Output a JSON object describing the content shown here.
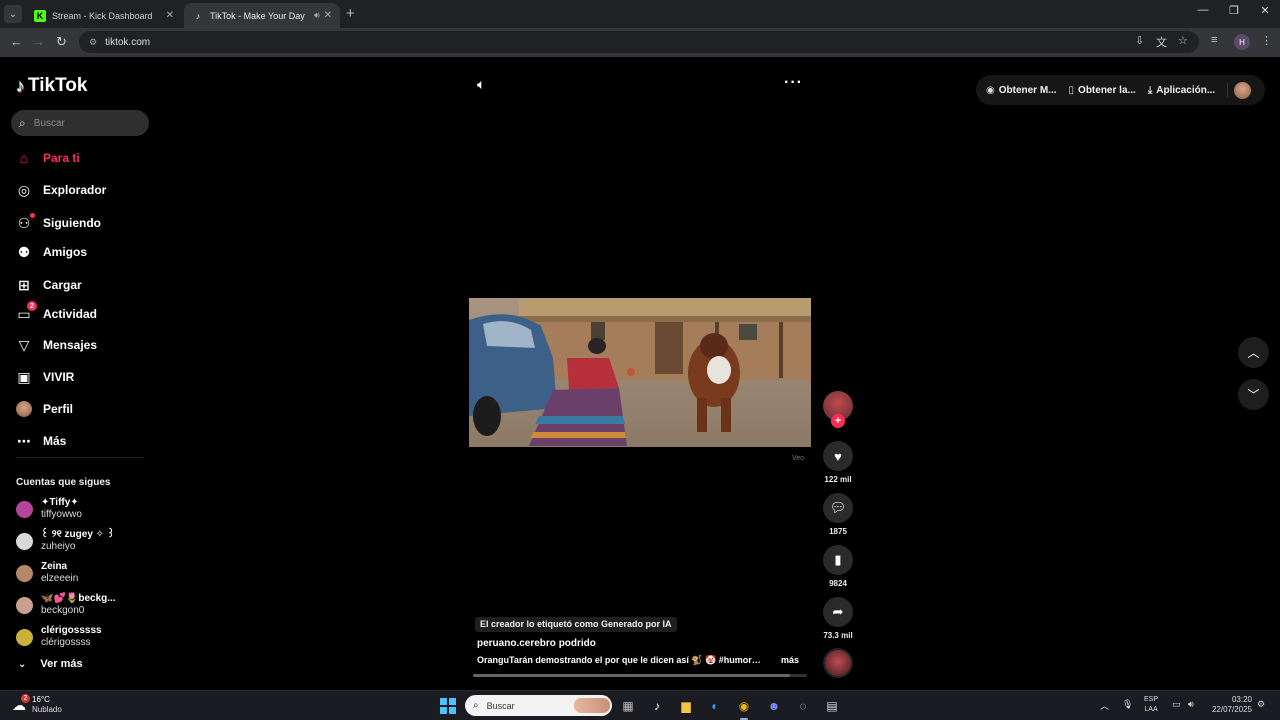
{
  "browser": {
    "tabs": [
      {
        "title": "Stream - Kick Dashboard",
        "favicon": "K",
        "favicon_color": "#53fc18"
      },
      {
        "title": "TikTok - Make Your Day",
        "favicon": "♪",
        "favicon_color": "#ffffff"
      }
    ],
    "url": "tiktok.com",
    "profile_initial": "H"
  },
  "tiktok": {
    "logo_text": "TikTok",
    "search_placeholder": "Buscar",
    "nav": [
      {
        "label": "Para ti",
        "icon": "home-icon",
        "active": true
      },
      {
        "label": "Explorador",
        "icon": "compass-icon"
      },
      {
        "label": "Siguiendo",
        "icon": "following-icon"
      },
      {
        "label": "Amigos",
        "icon": "friends-icon"
      },
      {
        "label": "Cargar",
        "icon": "upload-icon"
      },
      {
        "label": "Actividad",
        "icon": "activity-icon",
        "badge": "2"
      },
      {
        "label": "Mensajes",
        "icon": "messages-icon"
      },
      {
        "label": "VIVIR",
        "icon": "live-icon"
      },
      {
        "label": "Perfil",
        "icon": "profile-avatar"
      },
      {
        "label": "Más",
        "icon": "more-icon"
      }
    ],
    "following_title": "Cuentas que sigues",
    "following": [
      {
        "name": "✦Tiffy✦",
        "handle": "tiffyowwo",
        "color": "#b6459a"
      },
      {
        "name": "꒰ ୨୧ zugey ✧ ꒱",
        "handle": "zuheiyo",
        "color": "#d9d9d9"
      },
      {
        "name": "Zeina",
        "handle": "elzeeein",
        "color": "#b7876a"
      },
      {
        "name": "🦋💕🌷beckg...",
        "handle": "beckgon0",
        "color": "#c9a090"
      },
      {
        "name": "clérigosssss",
        "handle": "clérigossss",
        "color": "#c9b13a"
      }
    ],
    "see_more": "Ver más",
    "top_buttons": [
      {
        "label": "Obtener M...",
        "icon": "coin-icon"
      },
      {
        "label": "Obtener la...",
        "icon": "phone-icon"
      },
      {
        "label": "Aplicación...",
        "icon": "download-icon"
      }
    ],
    "video": {
      "watermark": "Veo",
      "ai_label": "El creador lo etiquetó como Generado por IA",
      "author": "peruano.cerebro podrido",
      "caption": "OranguTarán demostrando el por que le dicen así 🐒 🤡 #humoria ...",
      "caption_more": "más",
      "progress": 0.95
    },
    "actions": {
      "likes": "122 mil",
      "comments": "1875",
      "saves": "9824",
      "shares": "73.3 mil"
    },
    "accent": "#fe2c55"
  },
  "taskbar": {
    "weather_temp": "16°C",
    "weather_cond": "Nublado",
    "weather_badge": "2",
    "search_placeholder": "Buscar",
    "lang_top": "ESP",
    "lang_bottom": "LAA",
    "time": "03:20",
    "date": "22/07/2025"
  }
}
